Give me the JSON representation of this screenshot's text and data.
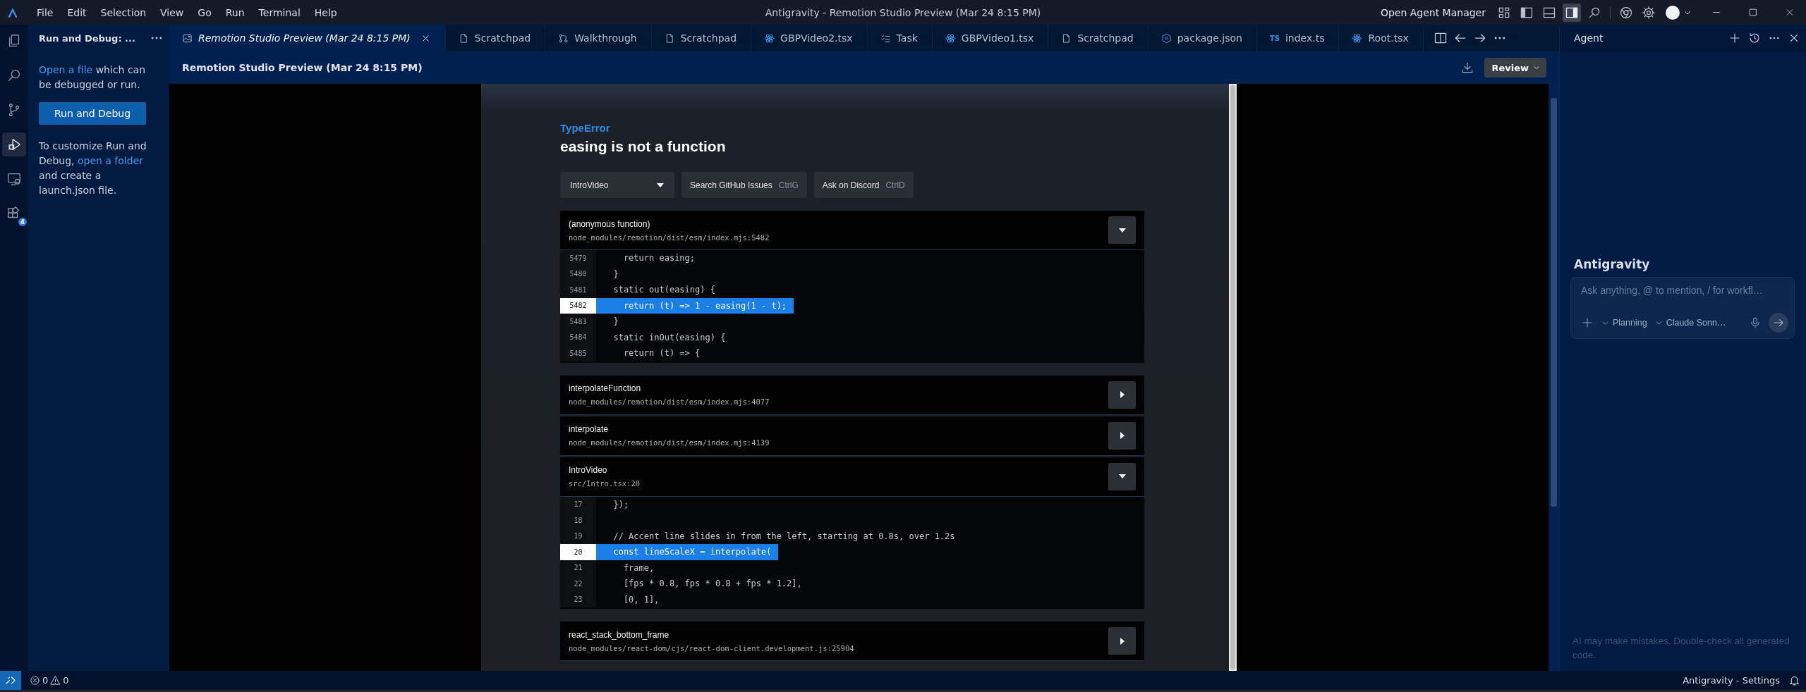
{
  "title_bar": {
    "menu": [
      "File",
      "Edit",
      "Selection",
      "View",
      "Go",
      "Run",
      "Terminal",
      "Help"
    ],
    "title": "Antigravity - Remotion Studio Preview (Mar 24 8:15 PM)",
    "agent_manager": "Open Agent Manager"
  },
  "activity_bar": [
    {
      "kind": "explorer",
      "selected": false
    },
    {
      "kind": "search",
      "selected": false
    },
    {
      "kind": "source-control",
      "selected": false
    },
    {
      "kind": "run-debug",
      "selected": true
    },
    {
      "kind": "remote",
      "selected": false
    },
    {
      "kind": "extensions",
      "selected": false,
      "badge": "4"
    }
  ],
  "sidebar": {
    "title": "Run and Debug: ...",
    "content": [
      {
        "kind": "paragraph",
        "parts": [
          {
            "text": "Open a file",
            "link": true
          },
          {
            "text": " which can be debugged or run.",
            "link": false
          }
        ]
      },
      {
        "kind": "button",
        "label": "Run and Debug"
      },
      {
        "kind": "paragraph",
        "parts": [
          {
            "text": "To customize Run and Debug, ",
            "link": false
          },
          {
            "text": "open a folder",
            "link": true
          },
          {
            "text": " and create a launch.json file.",
            "link": false
          }
        ]
      }
    ]
  },
  "tabs": [
    {
      "label": "Remotion Studio Preview (Mar 24 8:15 PM)",
      "kind": "preview",
      "preview": true,
      "selected": true
    },
    {
      "label": "Scratchpad",
      "kind": "file",
      "preview": false,
      "selected": false
    },
    {
      "label": "Walkthrough",
      "kind": "git",
      "preview": false,
      "selected": false
    },
    {
      "label": "Scratchpad",
      "kind": "file",
      "preview": false,
      "selected": false
    },
    {
      "label": "GBPVideo2.tsx",
      "kind": "react",
      "preview": false,
      "selected": false
    },
    {
      "label": "Task",
      "kind": "tasks",
      "preview": false,
      "selected": false
    },
    {
      "label": "GBPVideo1.tsx",
      "kind": "react",
      "preview": false,
      "selected": false
    },
    {
      "label": "Scratchpad",
      "kind": "file",
      "preview": false,
      "selected": false
    },
    {
      "label": "package.json",
      "kind": "node",
      "preview": false,
      "selected": false
    },
    {
      "label": "index.ts",
      "kind": "ts",
      "icon_text": "TS",
      "preview": false,
      "selected": false
    },
    {
      "label": "Root.tsx",
      "kind": "react",
      "preview": false,
      "selected": false
    }
  ],
  "editor_header": {
    "title": "Remotion Studio Preview (Mar 24 8:15 PM)",
    "review_button": "Review"
  },
  "error": {
    "type": "TypeError",
    "message": "easing is not a function",
    "composition": "IntroVideo",
    "actions": [
      {
        "label": "Search GitHub Issues",
        "shortcut": "CtrlG"
      },
      {
        "label": "Ask on Discord",
        "shortcut": "CtrlD"
      }
    ],
    "frames": [
      {
        "name": "(anonymous function)",
        "location": "node_modules/remotion/dist/esm/index.mjs:5482",
        "expanded": true,
        "lines": [
          {
            "number": "5479",
            "code": "    return easing;",
            "highlighted": false
          },
          {
            "number": "5480",
            "code": "  }",
            "highlighted": false
          },
          {
            "number": "5481",
            "code": "  static out(easing) {",
            "highlighted": false
          },
          {
            "number": "5482",
            "code": "    return (t) => 1 - easing(1 - t);",
            "highlighted": true
          },
          {
            "number": "5483",
            "code": "  }",
            "highlighted": false
          },
          {
            "number": "5484",
            "code": "  static inOut(easing) {",
            "highlighted": false
          },
          {
            "number": "5485",
            "code": "    return (t) => {",
            "highlighted": false
          }
        ]
      },
      {
        "name": "interpolateFunction",
        "location": "node_modules/remotion/dist/esm/index.mjs:4077",
        "expanded": false
      },
      {
        "name": "interpolate",
        "location": "node_modules/remotion/dist/esm/index.mjs:4139",
        "expanded": false
      },
      {
        "name": "IntroVideo",
        "location": "src/Intro.tsx:20",
        "expanded": true,
        "lines": [
          {
            "number": "17",
            "code": "  });",
            "highlighted": false
          },
          {
            "number": "18",
            "highlighted": false
          },
          {
            "number": "19",
            "code": "  // Accent line slides in from the left, starting at 0.8s, over 1.2s",
            "highlighted": false
          },
          {
            "number": "20",
            "code": "  const lineScaleX = interpolate(",
            "highlighted": true
          },
          {
            "number": "21",
            "code": "    frame,",
            "highlighted": false
          },
          {
            "number": "22",
            "code": "    [fps * 0.8, fps * 0.8 + fps * 1.2],",
            "highlighted": false
          },
          {
            "number": "23",
            "code": "    [0, 1],",
            "highlighted": false
          }
        ]
      },
      {
        "name": "react_stack_bottom_frame",
        "location": "node_modules/react-dom/cjs/react-dom-client.development.js:25904",
        "expanded": false
      }
    ]
  },
  "agent_panel": {
    "header": "Agent",
    "title": "Antigravity",
    "placeholder": "Ask anything, @ to mention, / for workfl…",
    "mode": "Planning",
    "model": "Claude Sonn…",
    "disclaimer": "AI may make mistakes. Double-check all generated code."
  },
  "status_bar": {
    "errors": "0",
    "warnings": "0",
    "settings": "Antigravity - Settings"
  }
}
